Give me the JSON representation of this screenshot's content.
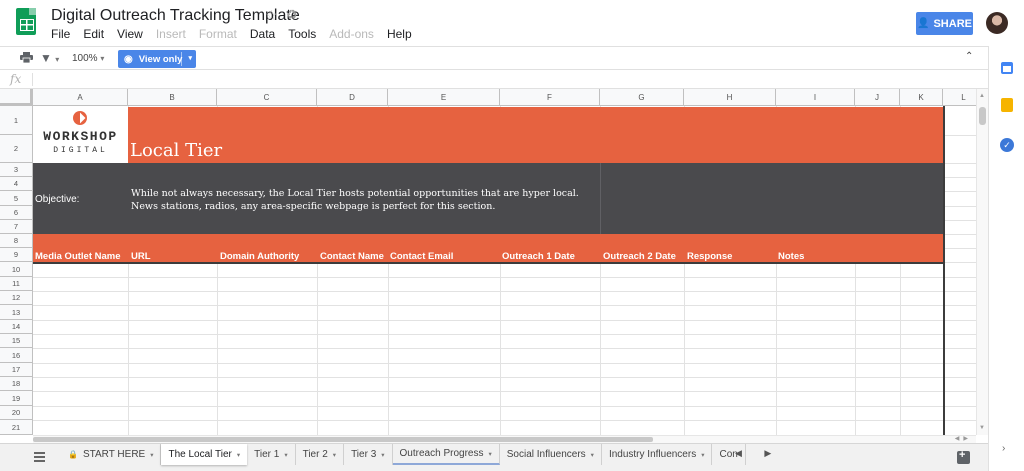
{
  "app": {
    "title": "Digital Outreach Tracking Template",
    "star_glyph": "☆",
    "drive_glyph": "♻",
    "share_label": "SHARE",
    "person_glyph": "👤"
  },
  "menu": [
    {
      "label": "File",
      "disabled": false
    },
    {
      "label": "Edit",
      "disabled": false
    },
    {
      "label": "View",
      "disabled": false
    },
    {
      "label": "Insert",
      "disabled": true
    },
    {
      "label": "Format",
      "disabled": true
    },
    {
      "label": "Data",
      "disabled": false
    },
    {
      "label": "Tools",
      "disabled": false
    },
    {
      "label": "Add-ons",
      "disabled": true
    },
    {
      "label": "Help",
      "disabled": false
    }
  ],
  "toolbar": {
    "zoom": "100%",
    "view_only_label": "View only",
    "eye_glyph": "◉",
    "caret_glyph": "▾",
    "collapse_glyph": "⌃"
  },
  "formula": {
    "fx": "fx"
  },
  "columns": [
    "A",
    "B",
    "C",
    "D",
    "E",
    "F",
    "G",
    "H",
    "I",
    "J",
    "K",
    "L"
  ],
  "rows": [
    "1",
    "2",
    "3",
    "4",
    "5",
    "6",
    "7",
    "8",
    "9",
    "10",
    "11",
    "12",
    "13",
    "14",
    "15",
    "16",
    "17",
    "18",
    "19",
    "20",
    "21"
  ],
  "sheet": {
    "logo_word": "WORKSHOP",
    "logo_sub": "DIGITAL",
    "tier_title": "Local Tier",
    "objective_label": "Objective:",
    "objective_text": "While not always necessary, the Local Tier hosts potential opportunities that are hyper local. News stations, radios, any area-specific webpage is perfect for this section.",
    "headers": [
      "Media Outlet Name",
      "URL",
      "Domain Authority",
      "Contact Name",
      "Contact Email",
      "Outreach 1 Date",
      "Outreach 2 Date",
      "Response",
      "Notes"
    ]
  },
  "tabs": [
    {
      "label": "START HERE",
      "locked": true,
      "active": false,
      "colored": false
    },
    {
      "label": "The Local Tier",
      "locked": false,
      "active": true,
      "colored": false
    },
    {
      "label": "Tier 1",
      "locked": false,
      "active": false,
      "colored": false
    },
    {
      "label": "Tier 2",
      "locked": false,
      "active": false,
      "colored": false
    },
    {
      "label": "Tier 3",
      "locked": false,
      "active": false,
      "colored": false
    },
    {
      "label": "Outreach Progress",
      "locked": false,
      "active": false,
      "colored": true
    },
    {
      "label": "Social Influencers",
      "locked": false,
      "active": false,
      "colored": false
    },
    {
      "label": "Industry Influencers",
      "locked": false,
      "active": false,
      "colored": false
    },
    {
      "label": "Con",
      "locked": false,
      "active": false,
      "colored": false
    }
  ],
  "tab_nav": "◀ ▶",
  "colors": {
    "accent_orange": "#e66240",
    "dark_band": "#4a4a4d",
    "share_blue": "#4a86e8"
  }
}
